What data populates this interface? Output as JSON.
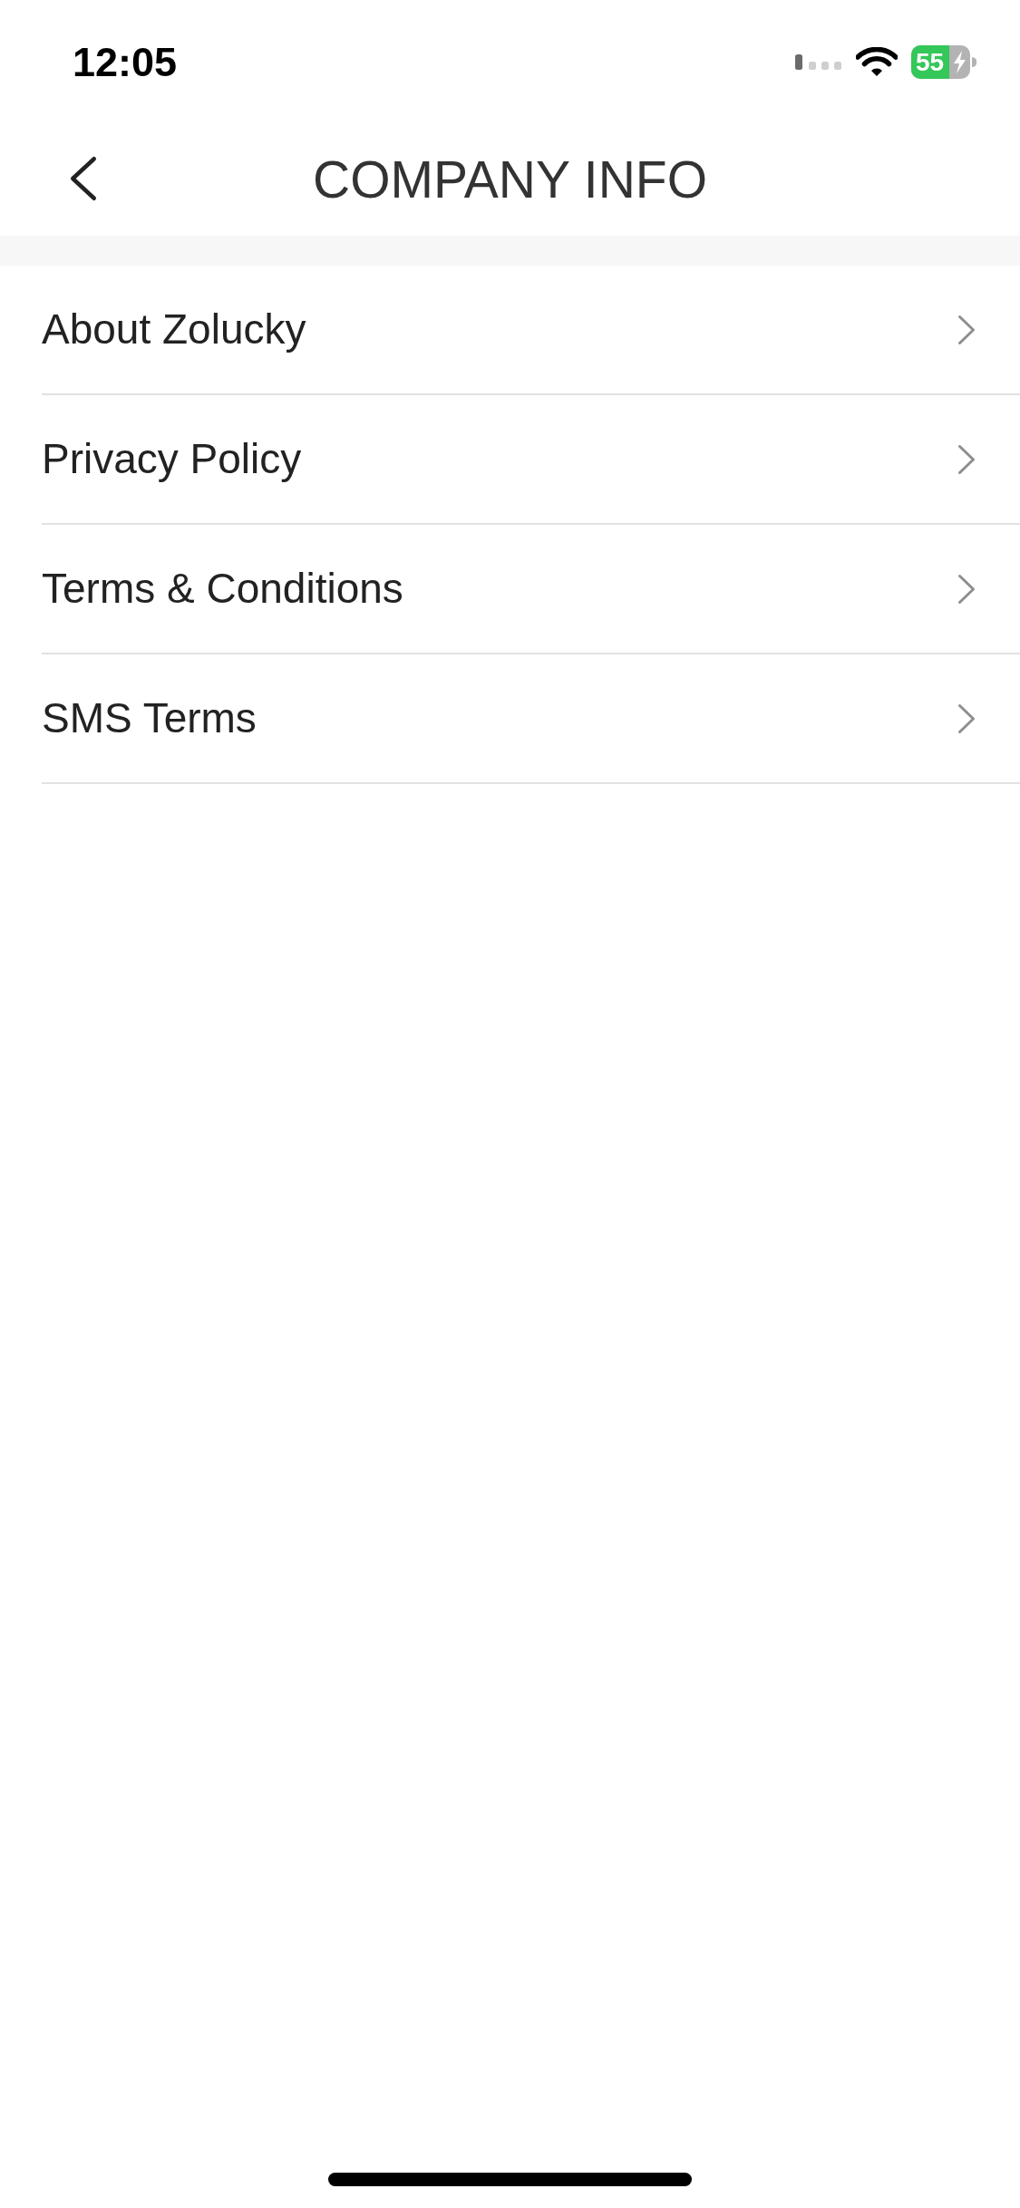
{
  "status_bar": {
    "time": "12:05",
    "battery": "55"
  },
  "header": {
    "title": "COMPANY INFO"
  },
  "menu": [
    {
      "label": "About Zolucky"
    },
    {
      "label": "Privacy Policy"
    },
    {
      "label": "Terms & Conditions"
    },
    {
      "label": "SMS Terms"
    }
  ]
}
